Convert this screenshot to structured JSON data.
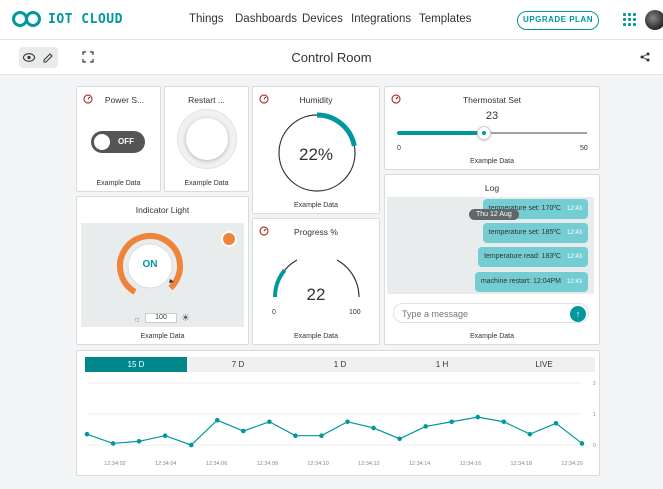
{
  "app": {
    "logo_text": "IOT CLOUD",
    "nav": [
      "Things",
      "Dashboards",
      "Devices",
      "Integrations",
      "Templates"
    ],
    "upgrade_label": "UPGRADE PLAN"
  },
  "toolbar": {
    "title": "Control Room"
  },
  "colors": {
    "accent": "#00979d",
    "orange": "#f0833a",
    "switch_off": "#555555"
  },
  "widgets": {
    "power": {
      "title": "Power S...",
      "state": "OFF",
      "footer": "Example Data"
    },
    "restart": {
      "title": "Restart ...",
      "footer": "Example Data"
    },
    "humidity": {
      "title": "Humidity",
      "value": "22%",
      "fraction": 0.22,
      "footer": "Example Data"
    },
    "thermostat": {
      "title": "Thermostat Set",
      "value": "23",
      "min": "0",
      "max": "50",
      "value_num": 23,
      "max_num": 50,
      "footer": "Example Data"
    },
    "indicator": {
      "title": "Indicator Light",
      "state": "ON",
      "brightness": "100",
      "footer": "Example Data"
    },
    "progress": {
      "title": "Progress %",
      "value": "22",
      "min": "0",
      "max": "100",
      "fraction": 0.22,
      "footer": "Example Data"
    },
    "log": {
      "title": "Log",
      "date_chip": "Thu 12 Aug",
      "messages": [
        {
          "text": "temperature set: 170ºC",
          "time": "12:43"
        },
        {
          "text": "temperature set: 185ºC",
          "time": "12:43"
        },
        {
          "text": "temperature read: 183ºC",
          "time": "12:43"
        },
        {
          "text": "machine restart: 12:04PM",
          "time": "12:43"
        }
      ],
      "placeholder": "Type a message",
      "footer": "Example Data"
    }
  },
  "chart_tabs": [
    "15 D",
    "7 D",
    "1 D",
    "1 H",
    "LIVE"
  ],
  "chart_data": {
    "type": "line",
    "x": [
      "12:34:02",
      "12:34:03",
      "12:34:04",
      "12:34:05",
      "12:34:06",
      "12:34:07",
      "12:34:08",
      "12:34:09",
      "12:34:10",
      "12:34:11",
      "12:34:12",
      "12:34:13",
      "12:34:14",
      "12:34:15",
      "12:34:16",
      "12:34:17",
      "12:34:18",
      "12:34:19",
      "12:34:20"
    ],
    "x_tick_labels": [
      "12:34:02",
      "12:34:04",
      "12:34:06",
      "12:34:08",
      "12:34:10",
      "12:34:12",
      "12:34:14",
      "12:34:16",
      "12:34:18",
      "12:34:20"
    ],
    "series": [
      {
        "values": [
          0.35,
          0.05,
          0.12,
          0.3,
          0.0,
          0.8,
          0.45,
          0.75,
          0.3,
          0.3,
          0.75,
          0.55,
          0.2,
          0.6,
          0.75,
          0.9,
          0.75,
          0.35,
          0.7,
          0.05
        ]
      }
    ],
    "ylim": [
      0,
      2
    ],
    "y_ticks": [
      "0",
      "1",
      "2"
    ],
    "grid": true
  }
}
